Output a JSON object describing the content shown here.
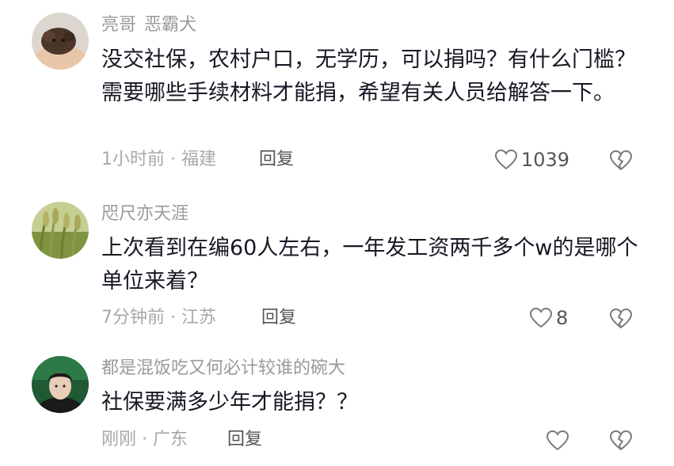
{
  "comments": [
    {
      "username_main": "亮哥",
      "username_tag": "恶霸犬",
      "text": "没交社保，农村户口，无学历，可以捐吗？有什么门槛？需要哪些手续材料才能捐，希望有关人员给解答一下。",
      "meta": "1小时前 · 福建",
      "reply_label": "回复",
      "like_count": "1039",
      "avatar_icon": "dog-photo-avatar",
      "colors": {
        "avatar_bg": "#d9d4cf",
        "avatar_fg": "#4a3528"
      }
    },
    {
      "username_main": "咫尺亦天涯",
      "text": "上次看到在编60人左右，一年发工资两千多个w的是哪个单位来着？",
      "meta": "7分钟前 · 江苏",
      "reply_label": "回复",
      "like_count": "8",
      "avatar_icon": "wheat-field-avatar",
      "colors": {
        "avatar_bg": "#a9b96a",
        "avatar_fg": "#6d7f33"
      }
    },
    {
      "username_main": "都是混饭吃又何必计较谁的碗大",
      "text": "社保要满多少年才能捐？？",
      "meta": "刚刚 · 广东",
      "reply_label": "回复",
      "like_count": "",
      "avatar_icon": "person-portrait-avatar",
      "colors": {
        "avatar_bg": "#1f5a34",
        "avatar_fg": "#1a1a1a"
      }
    }
  ],
  "colors": {
    "text": "#161823",
    "username": "#9a9a9a",
    "meta": "#a8a8a8",
    "icon": "#7a7a7a"
  }
}
